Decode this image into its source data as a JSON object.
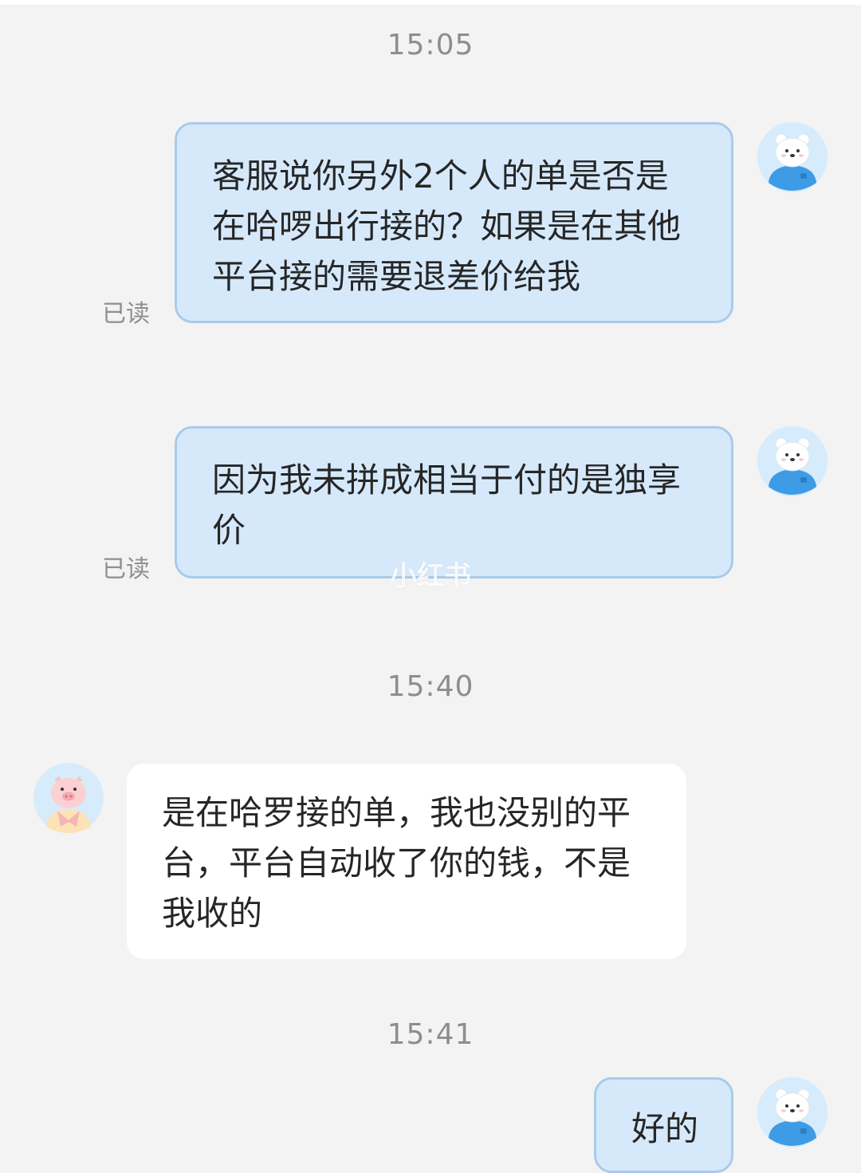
{
  "messages": [
    {
      "timestamp": "15:05"
    },
    {
      "text": "客服说你另外2个人的单是否是在哈啰出行接的？如果是在其他平台接的需要退差价给我",
      "status": "已读"
    },
    {
      "text": "因为我未拼成相当于付的是独享价",
      "status": "已读"
    },
    {
      "timestamp": "15:40"
    },
    {
      "text": "是在哈罗接的单，我也没别的平台，平台自动收了你的钱，不是我收的"
    },
    {
      "timestamp": "15:41"
    },
    {
      "text": "好的"
    }
  ],
  "watermark": "小红书",
  "colors": {
    "background": "#f3f3f3",
    "sent_bubble": "#d6e9fb",
    "sent_border": "#a9cbea",
    "received_bubble": "#ffffff",
    "meta_text": "#8d8d8d"
  },
  "icons": {
    "self_avatar": "polar-bear-avatar",
    "other_avatar": "pig-avatar"
  }
}
